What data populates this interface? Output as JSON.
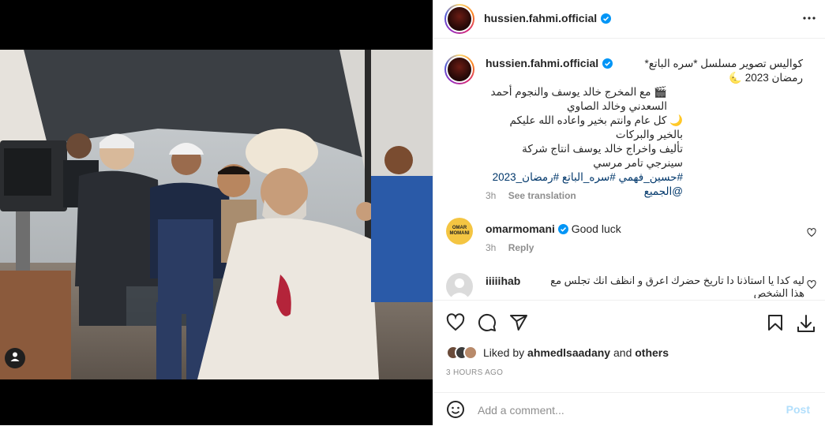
{
  "post": {
    "username": "hussien.fahmi.official",
    "more_icon": "more-horizontal-icon",
    "verified_icon": "verified-badge-icon",
    "caption": {
      "line1": "كواليس تصوير مسلسل *سره الباتع* رمضان 2023 🌜",
      "line2": "🎬 مع المخرج خالد يوسف والنجوم أحمد السعدني وخالد الصاوي",
      "line3": "🌙 كل عام وانتم بخير واعاده الله عليكم بالخير والبركات",
      "line4": "تأليف واخراج خالد يوسف انتاج شركة سينرجي تامر مرسي",
      "hashtags": "#حسين_فهمي #سره_الباتع #رمضان_2023 @الجميع"
    },
    "caption_time": "3h",
    "see_translation": "See translation"
  },
  "comments": [
    {
      "username": "omarmomani",
      "verified": true,
      "text": "Good luck",
      "time": "3h",
      "reply": "Reply",
      "avatar_text": "OMAR MOMANI"
    },
    {
      "username": "iiiiihab",
      "verified": false,
      "text": "ليه كدا يا استاذنا دا تاريخ حضرك اعرق و انظف انك تجلس مع هذا الشخص"
    }
  ],
  "actions": {
    "like_icon": "heart-icon",
    "comment_icon": "comment-icon",
    "share_icon": "send-icon",
    "save_icon": "bookmark-icon",
    "download_icon": "download-icon"
  },
  "likes": {
    "prefix": "Liked by",
    "user": "ahmedlsaadany",
    "and": "and",
    "others": "others"
  },
  "timestamp": "3 HOURS AGO",
  "add_comment": {
    "placeholder": "Add a comment...",
    "post_label": "Post",
    "emoji_icon": "emoji-icon"
  },
  "colors": {
    "verified": "#0095f6",
    "link": "#00376b",
    "muted": "#8e8e8e",
    "post_disabled": "#b2dffc"
  }
}
